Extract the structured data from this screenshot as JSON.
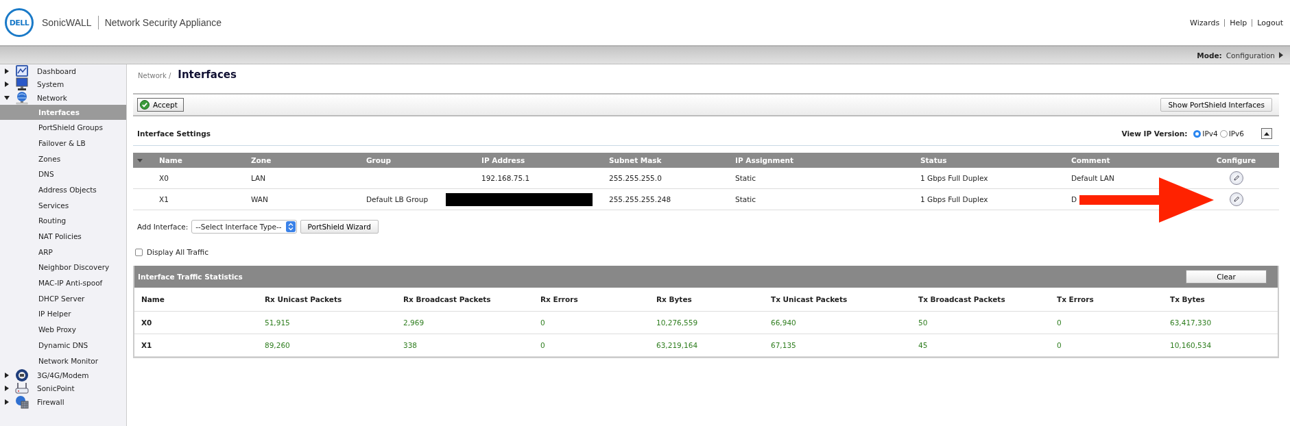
{
  "header": {
    "logo": "DELL",
    "brand": "SonicWALL",
    "product": "Network Security Appliance",
    "links": [
      "Wizards",
      "Help",
      "Logout"
    ]
  },
  "mode_bar": {
    "label": "Mode:",
    "value": "Configuration"
  },
  "sidebar": {
    "items": [
      {
        "label": "Dashboard",
        "expanded": false
      },
      {
        "label": "System",
        "expanded": false
      },
      {
        "label": "Network",
        "expanded": true,
        "children": [
          {
            "label": "Interfaces",
            "selected": true
          },
          {
            "label": "PortShield Groups",
            "selected": false
          },
          {
            "label": "Failover & LB",
            "selected": false
          },
          {
            "label": "Zones",
            "selected": false
          },
          {
            "label": "DNS",
            "selected": false
          },
          {
            "label": "Address Objects",
            "selected": false
          },
          {
            "label": "Services",
            "selected": false
          },
          {
            "label": "Routing",
            "selected": false
          },
          {
            "label": "NAT Policies",
            "selected": false
          },
          {
            "label": "ARP",
            "selected": false
          },
          {
            "label": "Neighbor Discovery",
            "selected": false
          },
          {
            "label": "MAC-IP Anti-spoof",
            "selected": false
          },
          {
            "label": "DHCP Server",
            "selected": false
          },
          {
            "label": "IP Helper",
            "selected": false
          },
          {
            "label": "Web Proxy",
            "selected": false
          },
          {
            "label": "Dynamic DNS",
            "selected": false
          },
          {
            "label": "Network Monitor",
            "selected": false
          }
        ]
      },
      {
        "label": "3G/4G/Modem",
        "expanded": false
      },
      {
        "label": "SonicPoint",
        "expanded": false
      },
      {
        "label": "Firewall",
        "expanded": false
      }
    ]
  },
  "breadcrumb": {
    "parent": "Network /",
    "title": "Interfaces"
  },
  "toolbar": {
    "accept": "Accept",
    "show_portshield": "Show PortShield Interfaces"
  },
  "interface_settings": {
    "title": "Interface Settings",
    "ip_version_label": "View IP Version:",
    "ip_versions": [
      {
        "label": "IPv4",
        "selected": true
      },
      {
        "label": "IPv6",
        "selected": false
      }
    ],
    "columns": [
      "Name",
      "Zone",
      "Group",
      "IP Address",
      "Subnet Mask",
      "IP Assignment",
      "Status",
      "Comment",
      "Configure"
    ],
    "rows": [
      {
        "name": "X0",
        "zone": "LAN",
        "group": "",
        "ip": "192.168.75.1",
        "ip_redacted": false,
        "mask": "255.255.255.0",
        "assignment": "Static",
        "status": "1 Gbps Full Duplex",
        "comment": "Default LAN"
      },
      {
        "name": "X1",
        "zone": "WAN",
        "group": "Default LB Group",
        "ip": "",
        "ip_redacted": true,
        "mask": "255.255.255.248",
        "assignment": "Static",
        "status": "1 Gbps Full Duplex",
        "comment": "D"
      }
    ],
    "add_interface_label": "Add Interface:",
    "add_interface_select": "--Select Interface Type--",
    "wizard_button": "PortShield Wizard",
    "display_all_traffic": {
      "label": "Display All Traffic",
      "checked": false
    }
  },
  "traffic_statistics": {
    "title": "Interface Traffic Statistics",
    "clear": "Clear",
    "columns": [
      "Name",
      "Rx Unicast Packets",
      "Rx Broadcast Packets",
      "Rx Errors",
      "Rx Bytes",
      "Tx Unicast Packets",
      "Tx Broadcast Packets",
      "Tx Errors",
      "Tx Bytes"
    ],
    "rows": [
      [
        "X0",
        "51,915",
        "2,969",
        "0",
        "10,276,559",
        "66,940",
        "50",
        "0",
        "63,417,330"
      ],
      [
        "X1",
        "89,260",
        "338",
        "0",
        "63,219,164",
        "67,135",
        "45",
        "0",
        "10,160,534"
      ]
    ]
  }
}
